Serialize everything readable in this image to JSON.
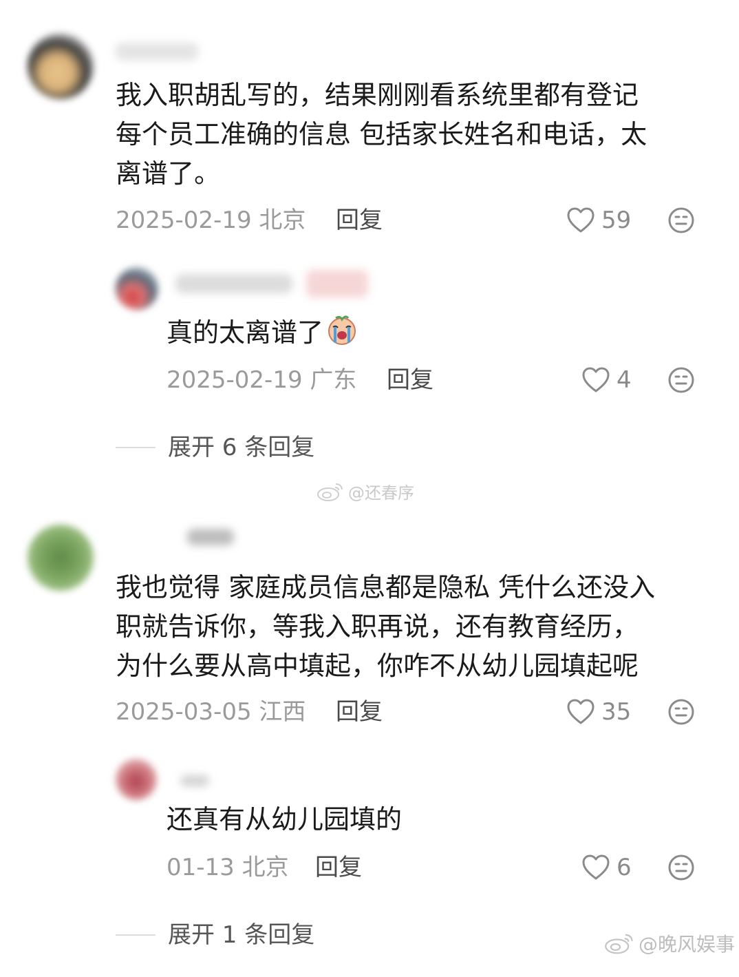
{
  "watermarks": {
    "center": "@还春序",
    "corner": "@晚风娱事"
  },
  "comments": [
    {
      "lines": [
        "我入职胡乱写的，结果刚刚看系统里都有登记",
        "每个员工准确的信息 包括家长姓名和电话，太",
        "离谱了。"
      ],
      "date": "2025-02-19",
      "location": "北京",
      "reply_label": "回复",
      "likes": "59",
      "replies": [
        {
          "text": "真的太离谱了",
          "emoji": "crying-face",
          "date": "2025-02-19",
          "location": "广东",
          "reply_label": "回复",
          "likes": "4"
        }
      ],
      "expand_label": "展开 6 条回复"
    },
    {
      "lines": [
        "我也觉得 家庭成员信息都是隐私 凭什么还没入",
        "职就告诉你，等我入职再说，还有教育经历，",
        "为什么要从高中填起，你咋不从幼儿园填起呢"
      ],
      "date": "2025-03-05",
      "location": "江西",
      "reply_label": "回复",
      "likes": "35",
      "replies": [
        {
          "text": "还真有从幼儿园填的",
          "date": "01-13",
          "location": "北京",
          "reply_label": "回复",
          "likes": "6"
        }
      ],
      "expand_label": "展开 1 条回复"
    }
  ]
}
